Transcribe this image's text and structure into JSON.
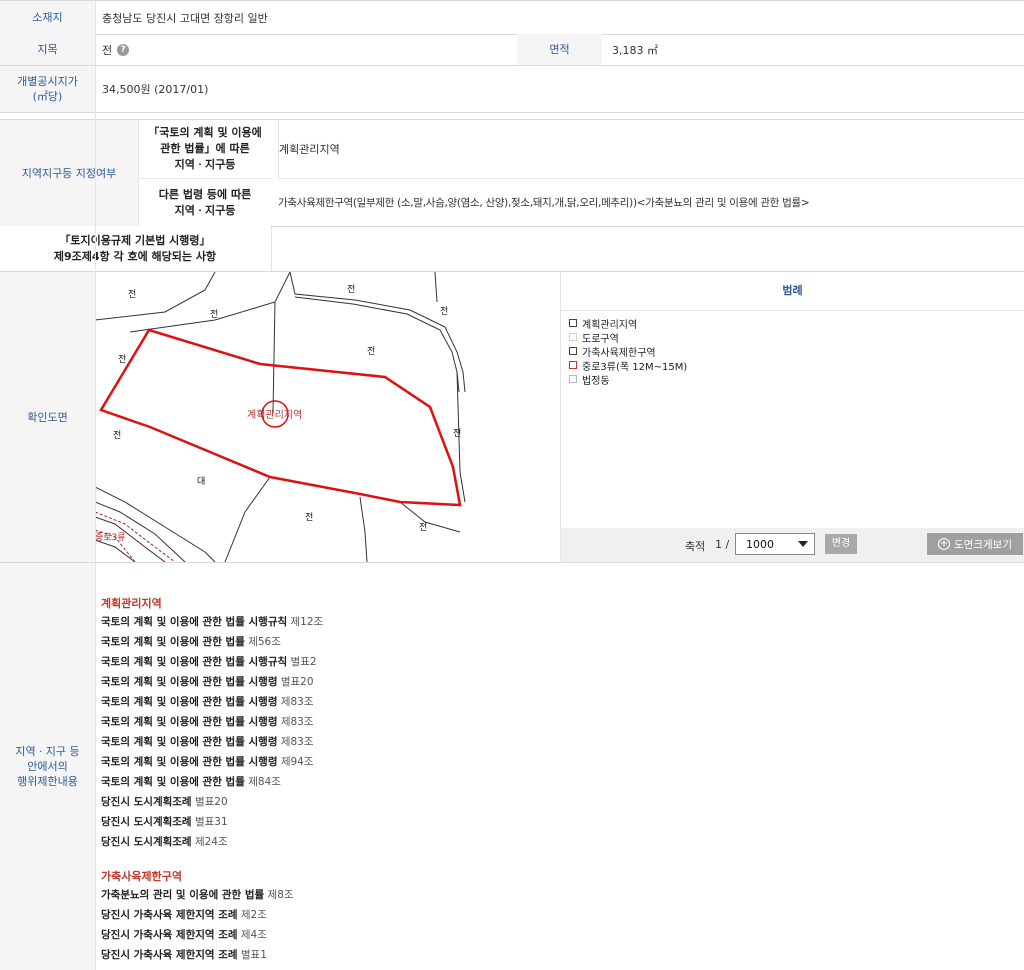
{
  "location": {
    "label": "소재지",
    "value": "충청남도 당진시 고대면 장항리 일반"
  },
  "land": {
    "category_label": "지목",
    "category_value": "전",
    "help_icon": "?",
    "area_label": "면적",
    "area_value": "3,183 ㎡"
  },
  "price": {
    "label_line1": "개별공시지가",
    "label_line2": "(㎡당)",
    "value": "34,500원 (2017/01)"
  },
  "zoning": {
    "label": "지역지구등 지정여부",
    "sub1_line1": "「국토의 계획 및 이용에",
    "sub1_line2": "관한 법률」에 따른",
    "sub1_line3": "지역ㆍ지구등",
    "sub1_value": "계획관리지역",
    "sub2_line1": "다른 법령 등에 따른",
    "sub2_line2": "지역ㆍ지구등",
    "sub2_value": "가축사육제한구역(일부제한 (소,말,사슴,양(염소, 산양),젖소,돼지,개,닭,오리,메추리))<가축분뇨의 관리 및 이용에 관한 법률>"
  },
  "enforcement": {
    "label_line1": "「토지이용규제 기본법 시행령」",
    "label_line2": "제9조제4항 각 호에 해당되는 사항",
    "value": ""
  },
  "map": {
    "label": "확인도면",
    "parcel_labels": [
      "전",
      "전",
      "전",
      "전",
      "전",
      "전",
      "전",
      "대",
      "전",
      "전",
      "전"
    ],
    "zone_text": "계획관리지역",
    "road_text": "중로3류"
  },
  "legend": {
    "title": "범례",
    "items": [
      {
        "label": "계획관리지역",
        "color": "#444444"
      },
      {
        "label": "도로구역",
        "color": "#d8d8b0"
      },
      {
        "label": "가축사육제한구역",
        "color": "#444444"
      },
      {
        "label": "중로3류(폭 12M~15M)",
        "color": "#c0392b"
      },
      {
        "label": "법정동",
        "color": "#bbbbbb"
      }
    ]
  },
  "scale": {
    "label": "축적",
    "prefix": "1 /",
    "value": "1000",
    "change_button": "변경",
    "enlarge_button": "도면크게보기"
  },
  "restrictions": {
    "label_line1": "지역ㆍ지구 등",
    "label_line2": "안에서의",
    "label_line3": "행위제한내용",
    "groups": [
      {
        "title": "계획관리지역",
        "items": [
          {
            "law": "국토의 계획 및 이용에 관한 법률 시행규칙",
            "article": "제12조"
          },
          {
            "law": "국토의 계획 및 이용에 관한 법률",
            "article": "제56조"
          },
          {
            "law": "국토의 계획 및 이용에 관한 법률 시행규칙",
            "article": "별표2"
          },
          {
            "law": "국토의 계획 및 이용에 관한 법률 시행령",
            "article": "별표20"
          },
          {
            "law": "국토의 계획 및 이용에 관한 법률 시행령",
            "article": "제83조"
          },
          {
            "law": "국토의 계획 및 이용에 관한 법률 시행령",
            "article": "제83조"
          },
          {
            "law": "국토의 계획 및 이용에 관한 법률 시행령",
            "article": "제83조"
          },
          {
            "law": "국토의 계획 및 이용에 관한 법률 시행령",
            "article": "제94조"
          },
          {
            "law": "국토의 계획 및 이용에 관한 법률",
            "article": "제84조"
          },
          {
            "law": "당진시 도시계획조례",
            "article": "별표20"
          },
          {
            "law": "당진시 도시계획조례",
            "article": "별표31"
          },
          {
            "law": "당진시 도시계획조례",
            "article": "제24조"
          }
        ]
      },
      {
        "title": "가축사육제한구역",
        "items": [
          {
            "law": "가축분뇨의 관리 및 이용에 관한 법률",
            "article": "제8조"
          },
          {
            "law": "당진시 가축사육 제한지역 조례",
            "article": "제2조"
          },
          {
            "law": "당진시 가축사육 제한지역 조례",
            "article": "제4조"
          },
          {
            "law": "당진시 가축사육 제한지역 조례",
            "article": "별표1"
          }
        ]
      }
    ]
  }
}
